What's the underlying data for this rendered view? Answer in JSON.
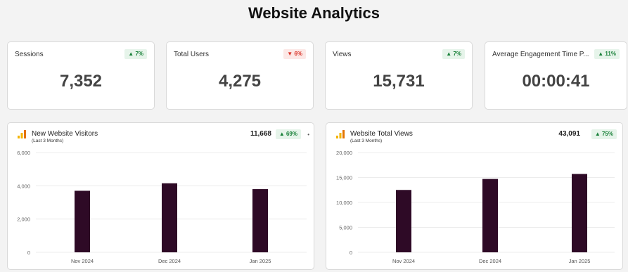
{
  "page": {
    "title": "Website Analytics"
  },
  "kpis": [
    {
      "label": "Sessions",
      "change": "7%",
      "direction": "up",
      "value": "7,352"
    },
    {
      "label": "Total Users",
      "change": "6%",
      "direction": "down",
      "value": "4,275"
    },
    {
      "label": "Views",
      "change": "7%",
      "direction": "up",
      "value": "15,731"
    },
    {
      "label": "Average Engagement Time P...",
      "change": "11%",
      "direction": "up",
      "value": "00:00:41"
    }
  ],
  "panels": [
    {
      "title": "New Website Visitors",
      "subtitle": "(Last 3 Months)",
      "total": "11,668",
      "change": "69%",
      "direction": "up",
      "icon": "bar-chart-icon",
      "more": "•"
    },
    {
      "title": "Website Total Views",
      "subtitle": "(Last 3 Months)",
      "total": "43,091",
      "change": "75%",
      "direction": "up",
      "icon": "bar-chart-icon"
    }
  ],
  "colors": {
    "bar": "#2e0a26",
    "up": "#188038",
    "down": "#d93025",
    "icon": "#f4b400"
  },
  "chart_data": [
    {
      "type": "bar",
      "categories": [
        "Nov 2024",
        "Dec 2024",
        "Jan 2025"
      ],
      "values": [
        3700,
        4150,
        3800
      ],
      "ylim": [
        0,
        6000
      ],
      "yticks": [
        0,
        2000,
        4000,
        6000
      ],
      "ytick_labels": [
        "0",
        "2,000",
        "4,000",
        "6,000"
      ],
      "grid": true
    },
    {
      "type": "bar",
      "categories": [
        "Nov 2024",
        "Dec 2024",
        "Jan 2025"
      ],
      "values": [
        12500,
        14700,
        15700
      ],
      "ylim": [
        0,
        20000
      ],
      "yticks": [
        0,
        5000,
        10000,
        15000,
        20000
      ],
      "ytick_labels": [
        "0",
        "5,000",
        "10,000",
        "15,000",
        "20,000"
      ],
      "grid": true
    }
  ]
}
